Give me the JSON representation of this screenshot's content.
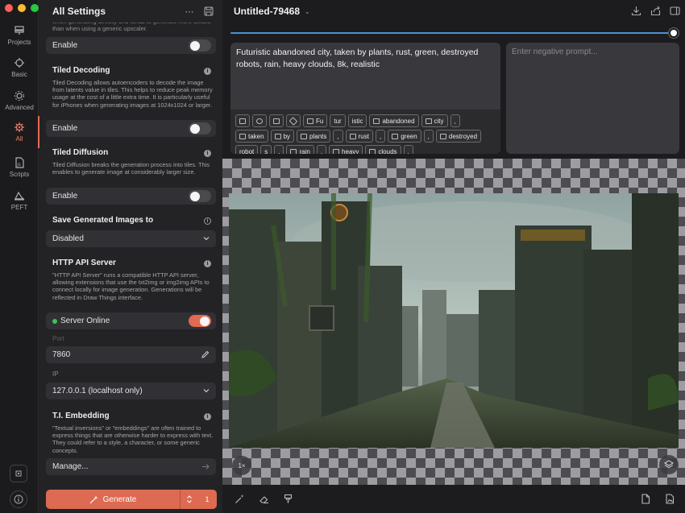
{
  "rail": {
    "items": [
      {
        "label": "Projects",
        "icon": "projects-icon"
      },
      {
        "label": "Basic",
        "icon": "basic-icon"
      },
      {
        "label": "Advanced",
        "icon": "advanced-icon"
      },
      {
        "label": "All",
        "icon": "gear-icon"
      },
      {
        "label": "Scripts",
        "icon": "scripts-icon"
      },
      {
        "label": "PEFT",
        "icon": "peft-icon"
      }
    ]
  },
  "settings": {
    "title": "All Settings",
    "cut_text": "when generating directly and tends to generate more details than when using a generic upscaler.",
    "upscaler_enable": "Enable",
    "tiled_decoding": {
      "title": "Tiled Decoding",
      "desc": "Tiled Decoding allows autoencoders to decode the image from latents value in tiles. This helps to reduce peak memory usage at the cost of a little extra time. It is particularly useful for iPhones when generating images at 1024x1024 or larger.",
      "enable": "Enable"
    },
    "tiled_diffusion": {
      "title": "Tiled Diffusion",
      "desc": "Tiled Diffusion breaks the generation process into tiles. This enables to generate image at considerably larger size.",
      "enable": "Enable"
    },
    "save_images": {
      "title": "Save Generated Images to",
      "value": "Disabled"
    },
    "http_api": {
      "title": "HTTP API Server",
      "desc": "\"HTTP API Server\" runs a compatible HTTP API server, allowing extensions that use the txt2img or img2img APIs to connect locally for image generation. Generations will be reflected in Draw Things interface.",
      "status": "Server Online",
      "port_label": "Port",
      "port_value": "7860",
      "ip_label": "IP",
      "ip_value": "127.0.0.1 (localhost only)"
    },
    "ti_embedding": {
      "title": "T.I. Embedding",
      "desc": "\"Textual inversions\" or \"embeddings\" are often trained to express things that are otherwise harder to express with text. They could refer to a style, a character, or some generic concepts.",
      "manage": "Manage..."
    },
    "generate": {
      "label": "Generate",
      "count": "1"
    }
  },
  "main": {
    "title": "Untitled-79468",
    "prompt": "Futuristic abandoned city, taken by plants, rust, green, destroyed robots, rain, heavy clouds, 8k, realistic",
    "negative_placeholder": "Enter negative prompt...",
    "tokens_row1": [
      "Fu",
      "tur",
      "istic",
      "abandoned",
      "city",
      ","
    ],
    "tokens_row2": [
      "taken",
      "by",
      "plants",
      ",",
      "rust",
      ",",
      "green",
      ","
    ],
    "tokens_row3": [
      "destroyed",
      "robot",
      "s",
      ",",
      "rain",
      ",",
      "heavy",
      "clouds",
      ","
    ],
    "zoom": "1×"
  },
  "colors": {
    "accent": "#e06b52",
    "slider": "#4a90d9",
    "online": "#34c759"
  }
}
